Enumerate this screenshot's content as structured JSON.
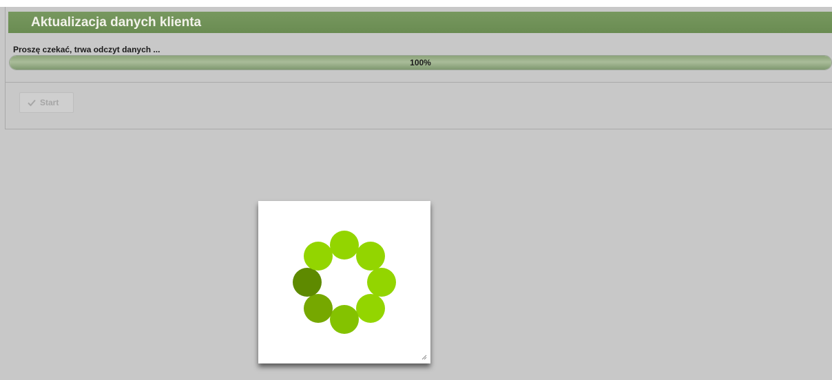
{
  "dialog": {
    "title": "Aktualizacja danych klienta",
    "status_text": "Proszę czekać, trwa odczyt danych ...",
    "progress": {
      "percent": 100,
      "label": "100%"
    },
    "start_button": {
      "label": "Start",
      "icon": "checkmark-icon",
      "disabled": true
    }
  },
  "loader": {
    "icon": "spinner-icon",
    "colors": {
      "active": "#5e8a00",
      "trail1": "#76a800",
      "trail2": "#84c200",
      "idle": "#93d500"
    }
  }
}
